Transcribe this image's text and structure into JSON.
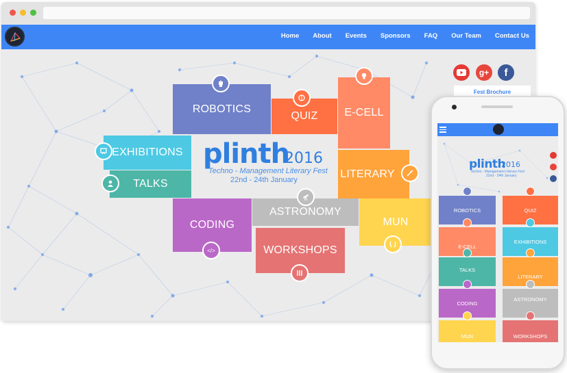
{
  "nav": {
    "links": [
      "Home",
      "About",
      "Events",
      "Sponsors",
      "FAQ",
      "Our Team",
      "Contact Us"
    ]
  },
  "logo": {
    "name": "logo-icon"
  },
  "hero": {
    "brand": "plinth",
    "year": "2016",
    "tagline": "Techno - Management Literary Fest",
    "dates": "22nd - 24th January"
  },
  "tiles": {
    "robotics": {
      "label": "ROBOTICS",
      "color": "#7081c9",
      "icon": "robot-icon"
    },
    "quiz": {
      "label": "QUIZ",
      "color": "#ff7043",
      "icon": "brain-icon"
    },
    "ecell": {
      "label": "E-CELL",
      "color": "#ff8a65",
      "icon": "idea-icon"
    },
    "exhibitions": {
      "label": "EXHIBITIONS",
      "color": "#4dc9e3",
      "icon": "exhibit-icon"
    },
    "talks": {
      "label": "TALKS",
      "color": "#4db6a7",
      "icon": "speaker-icon"
    },
    "literary": {
      "label": "LITERARY",
      "color": "#ffa33b",
      "icon": "quill-icon"
    },
    "coding": {
      "label": "CODING",
      "color": "#ba68c8",
      "icon": "code-icon"
    },
    "astronomy": {
      "label": "ASTRONOMY",
      "color": "#bdbdbd",
      "icon": "telescope-icon"
    },
    "mun": {
      "label": "MUN",
      "color": "#ffd54f",
      "icon": "laurel-icon"
    },
    "workshops": {
      "label": "WORKSHOPS",
      "color": "#e57373",
      "icon": "tools-icon"
    }
  },
  "social": {
    "youtube": {
      "icon": "youtube-icon",
      "color": "#e53935"
    },
    "gplus": {
      "icon": "google-plus-icon",
      "label": "g+",
      "color": "#e8453c"
    },
    "facebook": {
      "icon": "facebook-icon",
      "label": "f",
      "color": "#3b5998"
    }
  },
  "brochure": {
    "label": "Fest Brochure"
  },
  "phone": {
    "tiles": [
      "ROBOTICS",
      "QUIZ",
      "E-CELL",
      "EXHIBITIONS",
      "TALKS",
      "LITERARY",
      "CODING",
      "ASTRONOMY",
      "MUN",
      "WORKSHOPS"
    ]
  },
  "icons": {
    "code_glyph": "</>"
  },
  "colors": {
    "navbar": "#3e86f5",
    "brand": "#2f7fe0"
  }
}
